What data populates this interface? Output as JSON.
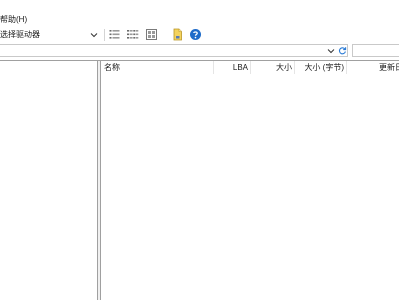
{
  "menu": {
    "help_label": "帮助(H)"
  },
  "toolbar": {
    "drive_select_label": "选择驱动器",
    "buttons": [
      {
        "name": "details-view-icon"
      },
      {
        "name": "list-view-icon"
      },
      {
        "name": "thumbnail-view-icon"
      },
      {
        "name": "bookmark-file-icon"
      },
      {
        "name": "help-icon"
      }
    ]
  },
  "address": {
    "value": ""
  },
  "search": {
    "value": ""
  },
  "file_list": {
    "columns": [
      "名称",
      "LBA",
      "大小",
      "大小 (字节)",
      "更新日"
    ]
  },
  "colors": {
    "accent": "#1e6bc9",
    "border": "#a0a0a0"
  }
}
